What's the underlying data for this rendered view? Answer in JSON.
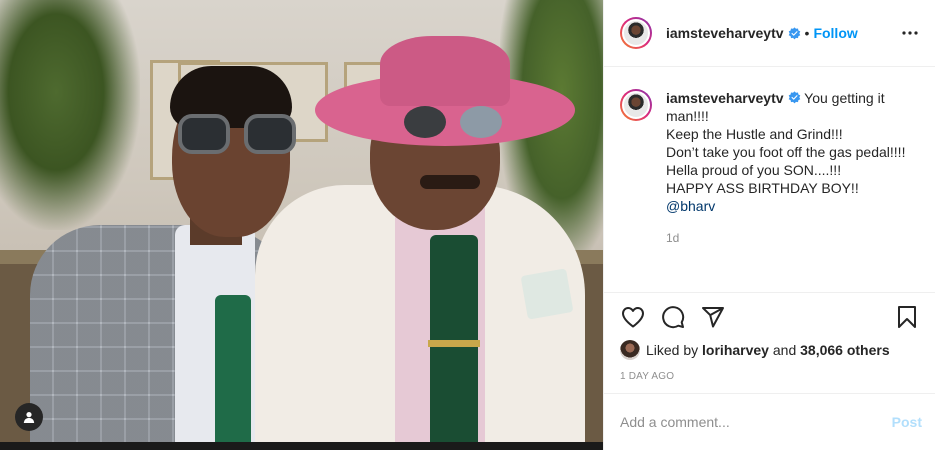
{
  "post": {
    "image_alt": ""
  },
  "header": {
    "username": "iamsteveharveytv",
    "separator": "•",
    "follow_label": "Follow",
    "verified": true
  },
  "caption": {
    "username": "iamsteveharveytv",
    "line1": "You getting it man!!!!",
    "line2": "Keep the Hustle and Grind!!!",
    "line3": "Don’t take you foot off the gas pedal!!!!",
    "line4": "Hella proud of you SON....!!!",
    "line5": "HAPPY ASS BIRTHDAY BOY!!",
    "mention": "@bharv",
    "age": "1d"
  },
  "likes": {
    "prefix": "Liked by",
    "user": "loriharvey",
    "and": "and",
    "others": "38,066 others"
  },
  "date": "1 DAY AGO",
  "comment": {
    "placeholder": "Add a comment...",
    "post_label": "Post"
  },
  "icons": {
    "like": "heart-icon",
    "comment": "comment-icon",
    "share": "paper-plane-icon",
    "save": "bookmark-icon",
    "more": "more-horizontal-icon",
    "verified": "verified-badge-icon",
    "tag": "user-tag-icon"
  },
  "colors": {
    "link": "#0095f6",
    "post_disabled": "#b2dffc",
    "text": "#262626",
    "muted": "#8e8e8e"
  }
}
